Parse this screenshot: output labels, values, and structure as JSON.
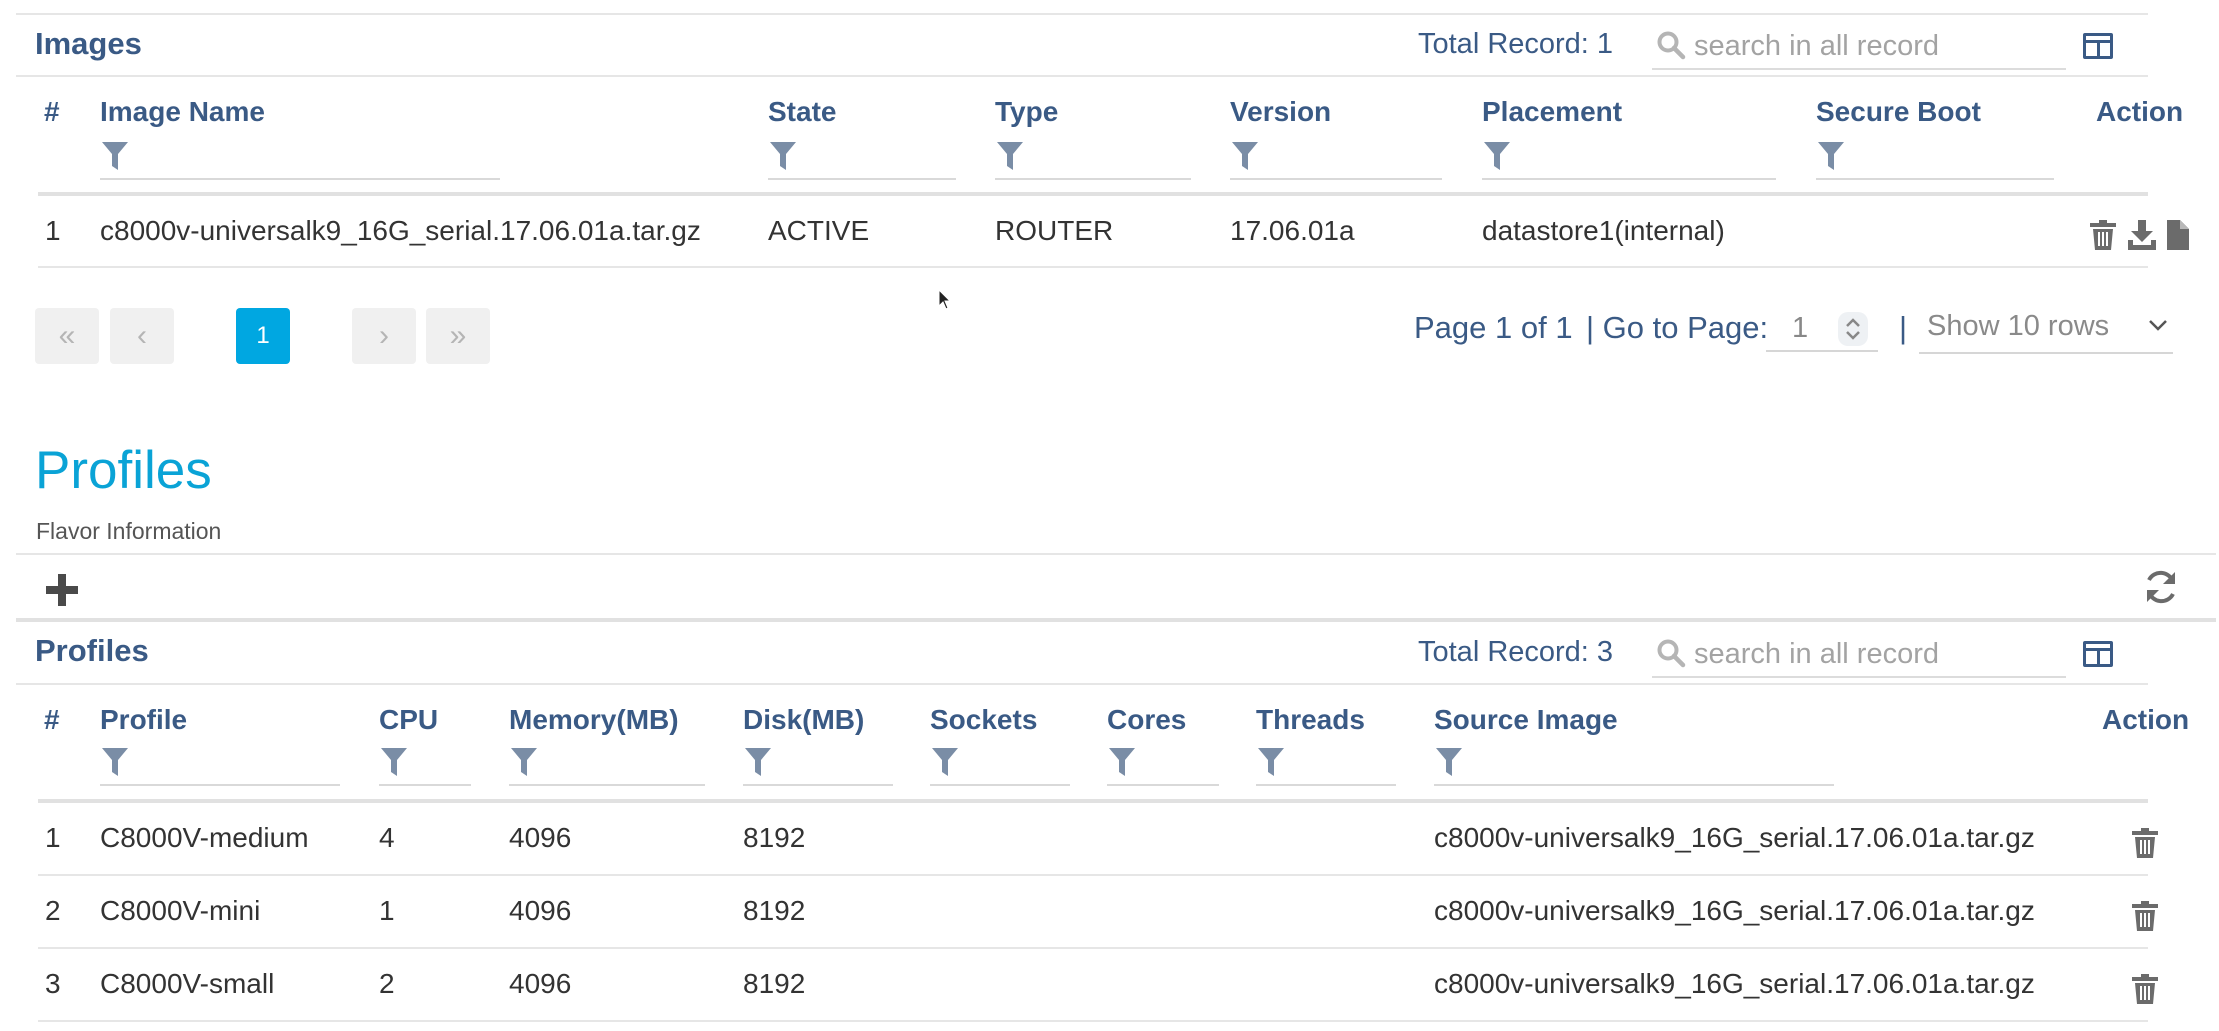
{
  "images": {
    "title": "Images",
    "total_record": "Total Record: 1",
    "search_placeholder": "search in all record",
    "columns": [
      "#",
      "Image Name",
      "State",
      "Type",
      "Version",
      "Placement",
      "Secure Boot",
      "Action"
    ],
    "rows": [
      {
        "num": "1",
        "name": "c8000v-universalk9_16G_serial.17.06.01a.tar.gz",
        "state": "ACTIVE",
        "type": "ROUTER",
        "version": "17.06.01a",
        "placement": "datastore1(internal)",
        "secure_boot": ""
      }
    ],
    "pagination": {
      "first": "«",
      "prev": "‹",
      "current": "1",
      "next": "›",
      "last": "»",
      "page_info": "Page 1 of 1",
      "go_to_label": "| Go to Page:",
      "go_to_value": "1",
      "separator": "|",
      "rows_option": "Show 10 rows"
    }
  },
  "profiles_header": {
    "title": "Profiles",
    "subtitle": "Flavor Information"
  },
  "profiles": {
    "title": "Profiles",
    "total_record": "Total Record: 3",
    "search_placeholder": "search in all record",
    "columns": [
      "#",
      "Profile",
      "CPU",
      "Memory(MB)",
      "Disk(MB)",
      "Sockets",
      "Cores",
      "Threads",
      "Source Image",
      "Action"
    ],
    "rows": [
      {
        "num": "1",
        "profile": "C8000V-medium",
        "cpu": "4",
        "memory": "4096",
        "disk": "8192",
        "sockets": "",
        "cores": "",
        "threads": "",
        "source": "c8000v-universalk9_16G_serial.17.06.01a.tar.gz"
      },
      {
        "num": "2",
        "profile": "C8000V-mini",
        "cpu": "1",
        "memory": "4096",
        "disk": "8192",
        "sockets": "",
        "cores": "",
        "threads": "",
        "source": "c8000v-universalk9_16G_serial.17.06.01a.tar.gz"
      },
      {
        "num": "3",
        "profile": "C8000V-small",
        "cpu": "2",
        "memory": "4096",
        "disk": "8192",
        "sockets": "",
        "cores": "",
        "threads": "",
        "source": "c8000v-universalk9_16G_serial.17.06.01a.tar.gz"
      }
    ]
  },
  "icons": {
    "add": "plus-icon",
    "refresh": "refresh-icon",
    "delete": "trash-icon",
    "download": "download-icon",
    "file": "file-icon",
    "search": "search-icon",
    "filter": "filter-icon",
    "columns": "columns-icon"
  },
  "colors": {
    "header_text": "#3a5a85",
    "accent": "#00a7e1",
    "page_title": "#0aa3d6"
  }
}
